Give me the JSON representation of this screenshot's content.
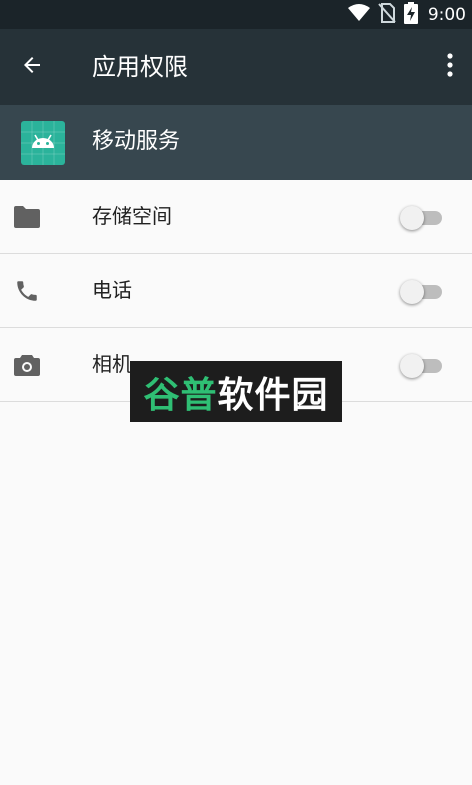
{
  "status_bar": {
    "time": "9:00",
    "icons": [
      "wifi-icon",
      "no-sim-icon",
      "battery-charging-icon"
    ]
  },
  "toolbar": {
    "title": "应用权限",
    "back_icon": "arrow-back-icon",
    "more_icon": "more-vert-icon"
  },
  "app": {
    "name": "移动服务",
    "icon": "android-icon",
    "icon_color": "#2bb39b"
  },
  "permissions": [
    {
      "label": "存储空间",
      "icon": "folder-icon",
      "enabled": false
    },
    {
      "label": "电话",
      "icon": "phone-icon",
      "enabled": false
    },
    {
      "label": "相机",
      "icon": "camera-icon",
      "enabled": false
    }
  ],
  "watermark": {
    "part1": "谷普",
    "part2": "软件园"
  },
  "colors": {
    "status_bar": "#1b2429",
    "toolbar": "#263238",
    "app_header": "#37474f",
    "switch_off_track": "#bdbdbd",
    "switch_off_thumb": "#f1f1f1"
  }
}
